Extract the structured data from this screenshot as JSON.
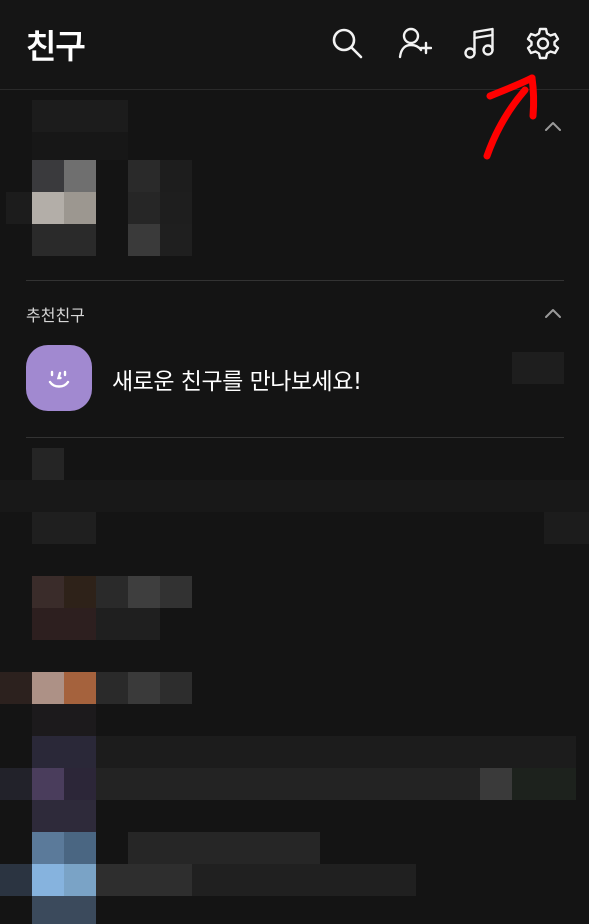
{
  "header": {
    "title": "친구",
    "icons": [
      "search-icon",
      "add-friend-icon",
      "music-icon",
      "settings-icon"
    ]
  },
  "recommended": {
    "section_label": "추천친구",
    "message": "새로운 친구를 만나보세요!"
  },
  "colors": {
    "background": "#141414",
    "avatar": "#a189d0",
    "annotation_arrow": "#ff0000"
  }
}
